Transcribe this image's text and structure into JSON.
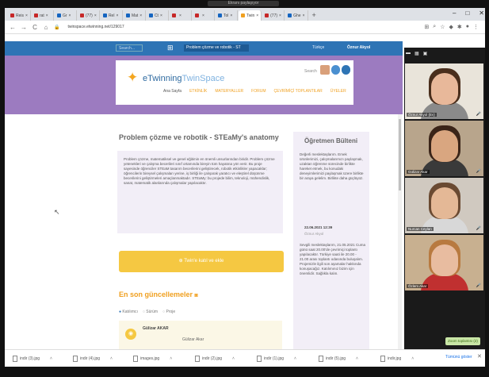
{
  "browser": {
    "tabs": [
      {
        "label": "Reis",
        "color": "#c62828"
      },
      {
        "label": "rat",
        "color": "#c62828"
      },
      {
        "label": "Gr",
        "color": "#1565c0"
      },
      {
        "label": "(77)",
        "color": "#c62828"
      },
      {
        "label": "Rel",
        "color": "#1565c0"
      },
      {
        "label": "Mat",
        "color": "#1565c0"
      },
      {
        "label": "Ct",
        "color": "#1565c0"
      },
      {
        "label": "",
        "color": "#c62828"
      },
      {
        "label": "",
        "color": "#c62828"
      },
      {
        "label": "Tol",
        "color": "#1565c0"
      },
      {
        "label": "Twin",
        "color": "#f0a020"
      },
      {
        "label": "(77)",
        "color": "#c62828"
      },
      {
        "label": "Ghe",
        "color": "#1565c0"
      }
    ],
    "new_tab": "+",
    "window_controls": {
      "minimize": "–",
      "maximize": "□",
      "close": "✕"
    },
    "back": "←",
    "forward": "→",
    "reload": "C",
    "home": "⌂",
    "url": "twinspace.etwinning.net/129017",
    "share_label": "Ekranı paylaşıyor"
  },
  "site": {
    "search_placeholder": "Search...",
    "apps_icon": "apps-grid-icon",
    "project_select": "Problem çözme ve robotik - ST",
    "language": "Türkçe",
    "user": "Öznur Akyol",
    "logo_text_main": "eTwinning",
    "logo_text_light": "TwinSpace",
    "logo_search": "Search",
    "menu": [
      "Ana Sayfa",
      "ETKİNLİK",
      "MATERYALLER",
      "FORUM",
      "ÇEVRİMİÇİ TOPLANTILAR",
      "ÜYELER"
    ]
  },
  "main": {
    "title": "Problem çözme ve robotik - STEaMy's anatomy",
    "description": "Problem çözme, matematiksel ve genel eğitimin en önemli unsurlarından biridir. Problem çözme yetenekleri ve çalışma becerileri sınıf ortamında bireyin tüm hayatına yön verir. Bu proje sayesinde öğrenciler STEaM tasarım becerilerini geliştirecek, robotik etkinlikler yapacaklar; öğrencilerin bireysel çalışmaları yerine, iş birliği ile çalışarak yaratıcı ve eleştirel düşünme becerilerini geliştirmeleri amaçlanmaktadır. STEaMy: bu projede bilim, teknoloji, mühendislik, sanat, matematik alanlarında çalışmalar yapılacaktır.",
    "join_button": "Twin'e katıl ve ekle",
    "updates_title": "En son güncellemeler",
    "filters": [
      "Katılımcı",
      "Sürüm",
      "Proje"
    ],
    "update_name": "Gülizar AKAR",
    "update_sub": "Gülizar Akar"
  },
  "bulletin": {
    "title": "Öğretmen Bülteni",
    "item1": "Değerli meslektaşlarım. Emek ürünlerimizi, çalışmalarımızı paylaşmak, uzaktan öğrenme sürecinde birlikte hareket etmek, bu konudaki deneyimlerimizi paylaşmak üzere birlikte bir araya gelelim. Birlikte daha güçlüyüz.",
    "date1": "22.06.2021 12:39",
    "author1": "Öznur Akyol",
    "item2": "Sevgili meslektaşlarım, 21.05.2021 Cuma günü saat 20.00'de çevrimiçi toplantı yapılacaktır. Türkiye saati ile 20.00 - 21.00 arası toplantı odasında buluşalım. Projemizle ilgili son aşamalar hakkında konuşacağız. Katılımınız bizim için önemlidir. Sağlıkla kalın."
  },
  "video_gallery": {
    "participants": [
      {
        "name": "Öznur Akyol (Ev)",
        "skin": "#e8b89a",
        "hair": "#4a2e1c",
        "wall": "#e9e4da",
        "shirt": "#8a8a8a"
      },
      {
        "name": "Gülizar Akar",
        "skin": "#d9a680",
        "hair": "#3a2418",
        "wall": "#b8a58c",
        "shirt": "#3a3a3a"
      },
      {
        "name": "Nurcan Ceylan",
        "skin": "#e4b896",
        "hair": "#6a4a32",
        "wall": "#d0c9c0",
        "shirt": "#d8d8d8"
      },
      {
        "name": "Özlem Akar",
        "skin": "#e8bca0",
        "hair": "#b87a40",
        "wall": "#c8b090",
        "shirt": "#c03030"
      }
    ],
    "muted_icon": "mic-off-icon"
  },
  "downloads": {
    "items": [
      "indir (3).jpg",
      "indir (4).jpg",
      "images.jpg",
      "indir (2).jpg",
      "indir (1).jpg",
      "indir (5).jpg",
      "indir.jpg"
    ],
    "show_all": "Tümünü göster",
    "close": "✕",
    "zoom_note": "Zoom toplantısı (2)"
  },
  "colors": {
    "site_blue": "#2e74b5",
    "site_purple": "#9c7bc0",
    "accent_yellow": "#f5c842",
    "accent_orange": "#f0a020"
  }
}
